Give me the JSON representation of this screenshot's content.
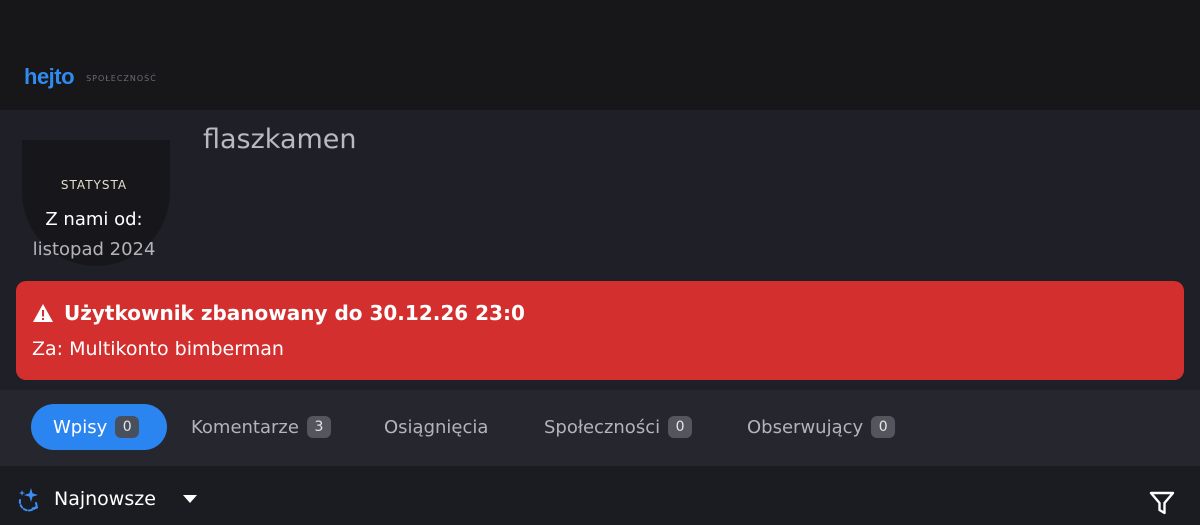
{
  "header": {
    "logo_text": "hejto",
    "logo_subtitle": "SPOŁECZNOŚĆ"
  },
  "profile": {
    "username": "flaszkamen",
    "role": "STATYSTA",
    "member_since_label": "Z nami od:",
    "member_since_value": "listopad 2024"
  },
  "ban_notice": {
    "title": "Użytkownik zbanowany do 30.12.26 23:0",
    "reason": "Za: Multikonto bimberman",
    "icon": "warning-icon",
    "color": "#d32f2f"
  },
  "tabs": [
    {
      "label": "Wpisy",
      "count": "0",
      "active": true
    },
    {
      "label": "Komentarze",
      "count": "3",
      "active": false
    },
    {
      "label": "Osiągnięcia",
      "count": null,
      "active": false
    },
    {
      "label": "Społeczności",
      "count": "0",
      "active": false
    },
    {
      "label": "Obserwujący",
      "count": "0",
      "active": false
    }
  ],
  "sort": {
    "label": "Najnowsze",
    "icon": "sparkle-icon"
  },
  "filter": {
    "icon": "filter-icon"
  },
  "colors": {
    "accent": "#2b85f0",
    "danger": "#d32f2f",
    "background": "#1b1c21"
  }
}
